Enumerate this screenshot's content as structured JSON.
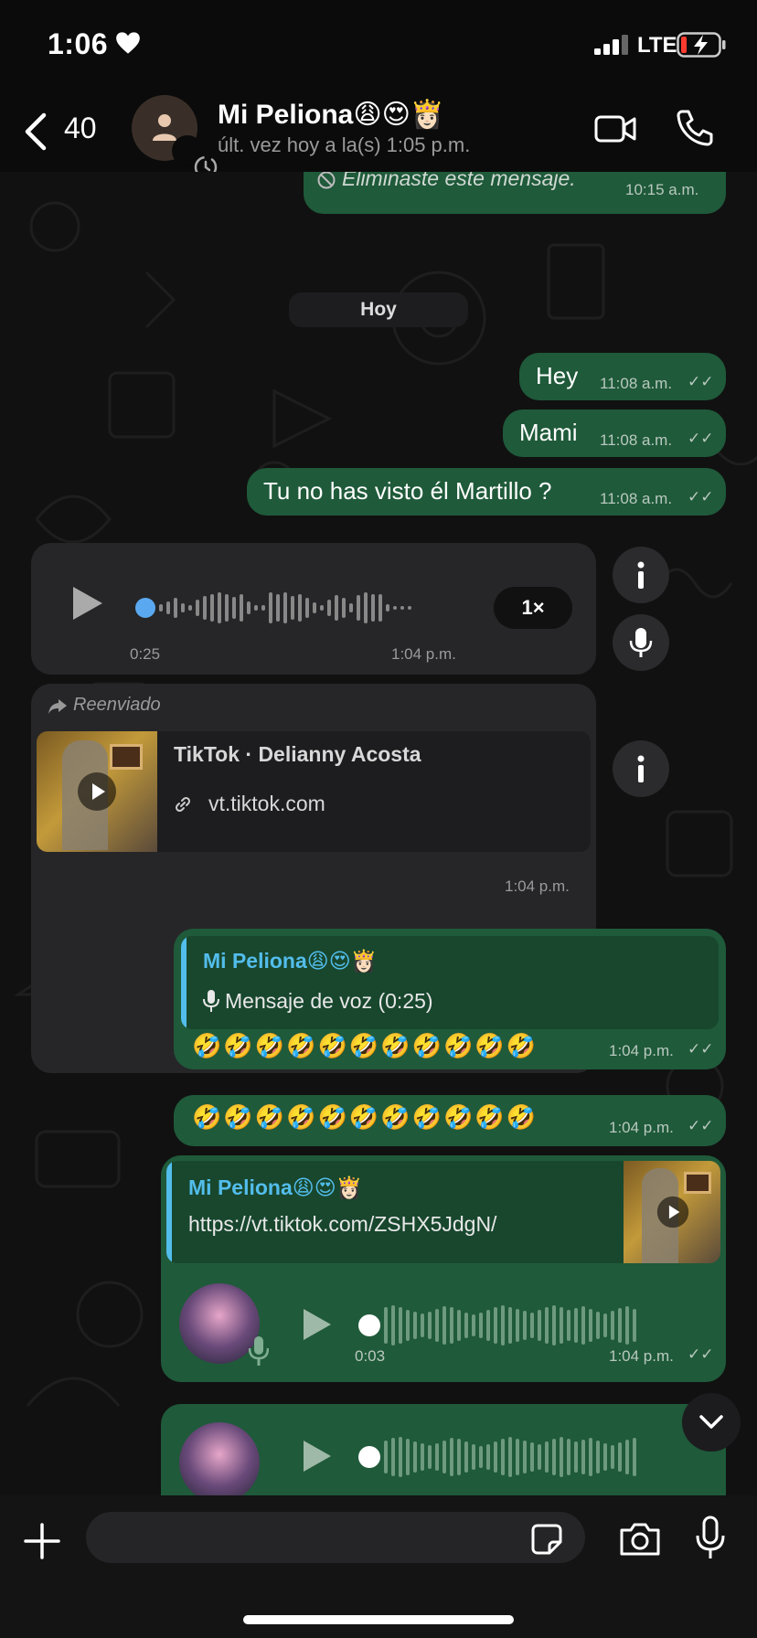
{
  "status_bar": {
    "time": "1:06",
    "network": "LTE"
  },
  "header": {
    "back_count": "40",
    "contact_name": "Mi Peliona😩😍👸🏻",
    "last_seen": "últ. vez hoy a la(s) 1:05 p.m."
  },
  "messages": {
    "deleted": {
      "text": "Eliminaste este mensaje.",
      "time": "10:15 a.m."
    },
    "day_separator": "Hoy",
    "hey": {
      "text": "Hey",
      "time": "11:08 a.m."
    },
    "mami": {
      "text": "Mami",
      "time": "11:08 a.m."
    },
    "martillo": {
      "text": "Tu no has visto él Martillo ?",
      "time": "11:08 a.m."
    },
    "voice_in": {
      "duration": "0:25",
      "time": "1:04 p.m.",
      "speed": "1×"
    },
    "forwarded": {
      "label": "Reenviado",
      "title": "TikTok · Delianny Acosta",
      "domain": "vt.tiktok.com",
      "time": "1:04 p.m."
    },
    "reply_voice": {
      "quote_name": "Mi Peliona😩😍👸🏻",
      "quote_text": "Mensaje de voz (0:25)",
      "emojis": "🤣🤣🤣🤣🤣🤣🤣🤣🤣🤣🤣",
      "time": "1:04 p.m."
    },
    "emoji_only": {
      "emojis": "🤣🤣🤣🤣🤣🤣🤣🤣🤣🤣🤣",
      "time": "1:04 p.m."
    },
    "reply_link": {
      "quote_name": "Mi Peliona😩😍👸🏻",
      "quote_text": "https://vt.tiktok.com/ZSHX5JdgN/",
      "duration": "0:03",
      "time": "1:04 p.m."
    }
  },
  "colors": {
    "outgoing": "#1f5a3a",
    "incoming": "#262628",
    "quote_accent": "#53bdeb"
  },
  "icons": [
    "heart-icon",
    "signal-icon",
    "battery-charging-icon",
    "back-chevron-icon",
    "video-call-icon",
    "phone-icon",
    "play-icon",
    "mic-icon",
    "info-icon",
    "forward-icon",
    "link-icon",
    "plus-icon",
    "sticker-icon",
    "camera-icon",
    "scroll-down-icon"
  ]
}
